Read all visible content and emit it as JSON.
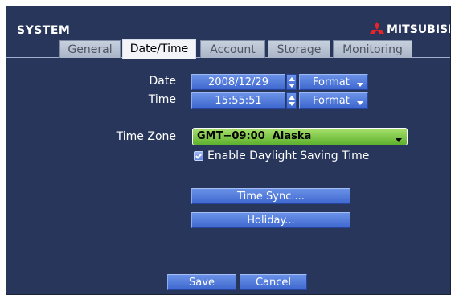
{
  "header": {
    "title": "SYSTEM",
    "brand": "MITSUBISHI",
    "brand_color": "#e8242a"
  },
  "tabs": [
    {
      "label": "General",
      "active": false
    },
    {
      "label": "Date/Time",
      "active": true
    },
    {
      "label": "Account",
      "active": false
    },
    {
      "label": "Storage",
      "active": false
    },
    {
      "label": "Monitoring",
      "active": false
    }
  ],
  "date": {
    "label": "Date",
    "value": "2008/12/29",
    "format_label": "Format"
  },
  "time": {
    "label": "Time",
    "value": "15:55:51",
    "format_label": "Format"
  },
  "timezone": {
    "label": "Time Zone",
    "value": "GMT−09:00  Alaska"
  },
  "dst": {
    "label": "Enable Daylight Saving Time",
    "checked": true
  },
  "buttons": {
    "time_sync": "Time Sync....",
    "holiday": "Holiday...",
    "save": "Save",
    "cancel": "Cancel"
  },
  "colors": {
    "background": "#27365a",
    "button": "#4f78db",
    "dropdown": "#7ec84a"
  }
}
